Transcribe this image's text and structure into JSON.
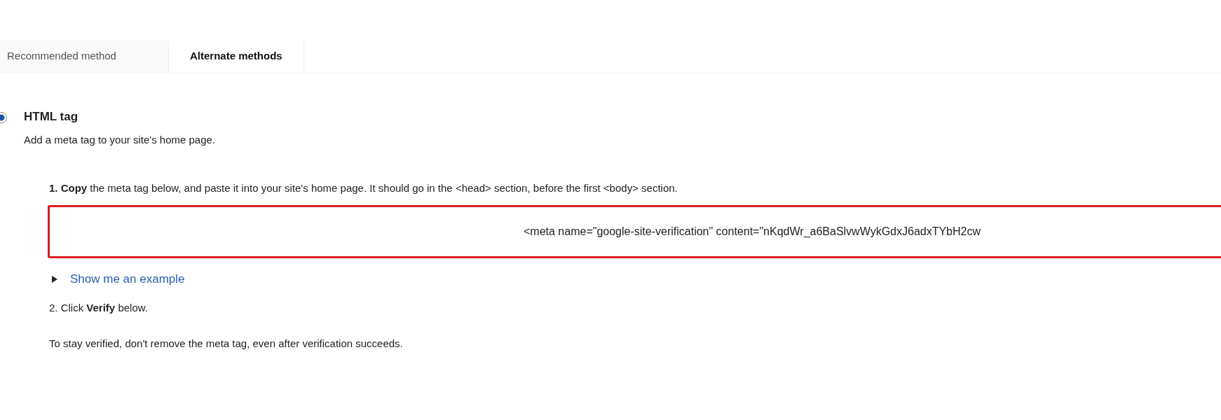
{
  "tabs": [
    {
      "label": "Recommended method",
      "selected": false
    },
    {
      "label": "Alternate methods",
      "selected": true
    }
  ],
  "method": {
    "title": "HTML tag",
    "selected": true,
    "description": "Add a meta tag to your site's home page."
  },
  "steps": [
    {
      "kind": "copy",
      "text": "**1. Copy** the meta tag below, and paste it into your site's home page. It should go in the <head> section, before the first <body> section.",
      "field_value": "<meta name=\"google-site-verification\" content=\"nKqdWr_a6BaSlvwWykGdxJ6adxTYbH2cw",
      "link": "Show me an example",
      "expanded": false
    },
    {
      "kind": "plain",
      "text": "2. Click **Verify** below."
    }
  ],
  "note": "To stay verified, don't remove the meta tag, even after verification succeeds."
}
